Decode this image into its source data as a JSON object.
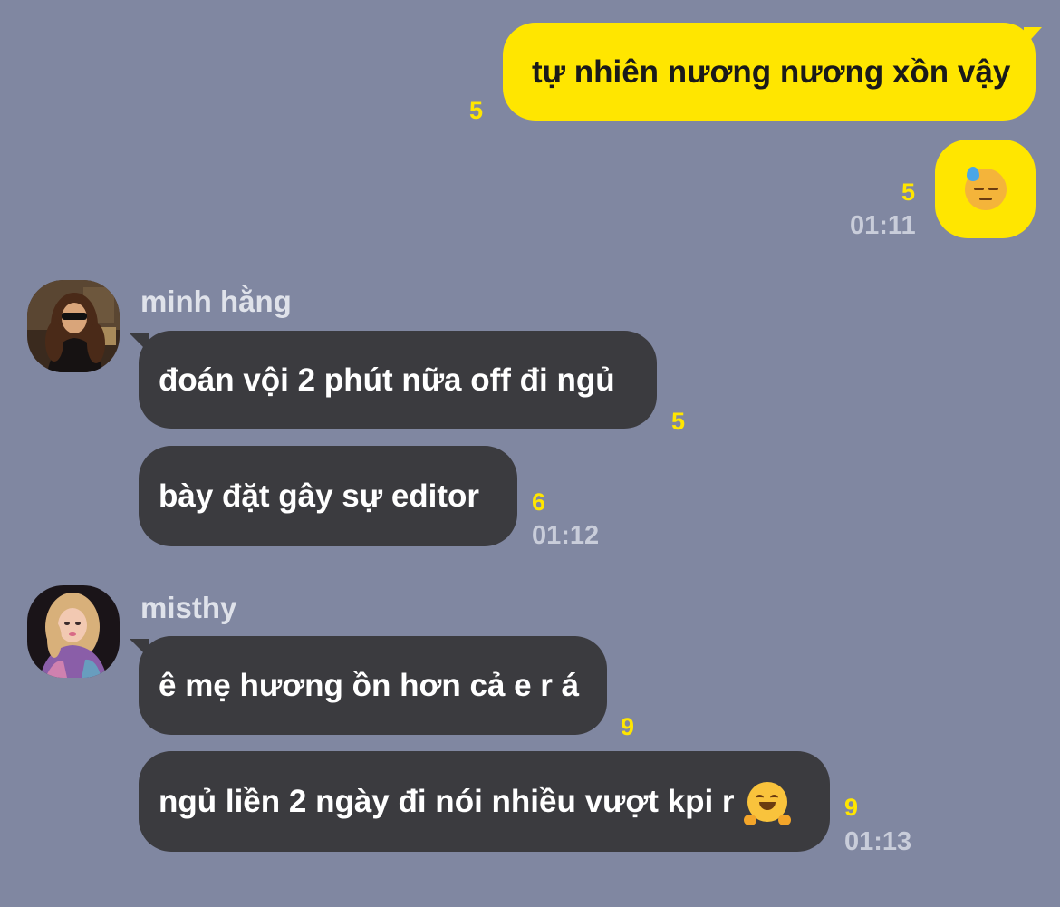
{
  "conversation": {
    "outgoing": [
      {
        "text": "tự nhiên nương nương xồn vậy",
        "read_count": "5"
      },
      {
        "emoji": "downcast-face-with-sweat",
        "read_count": "5",
        "time": "01:11"
      }
    ],
    "groups": [
      {
        "sender_name": "minh hằng",
        "avatar": "photo-woman-sunglasses",
        "messages": [
          {
            "text": "đoán vội 2 phút nữa off đi ngủ",
            "read_count": "5"
          },
          {
            "text": "bày đặt gây sự editor",
            "read_count": "6",
            "time": "01:12"
          }
        ]
      },
      {
        "sender_name": "misthy",
        "avatar": "photo-woman-pink-hair",
        "messages": [
          {
            "text": "ê mẹ hương ồn hơn cả e r á",
            "read_count": "9"
          },
          {
            "text": "ngủ liền 2 ngày đi nói nhiều vượt kpi r",
            "emoji": "hugging-face",
            "read_count": "9",
            "time": "01:13"
          }
        ]
      }
    ]
  },
  "colors": {
    "background": "#8087a1",
    "outgoing_bubble": "#ffe600",
    "incoming_bubble": "#3b3b3f",
    "read_count": "#ffe600",
    "timestamp": "#c9cdda"
  }
}
